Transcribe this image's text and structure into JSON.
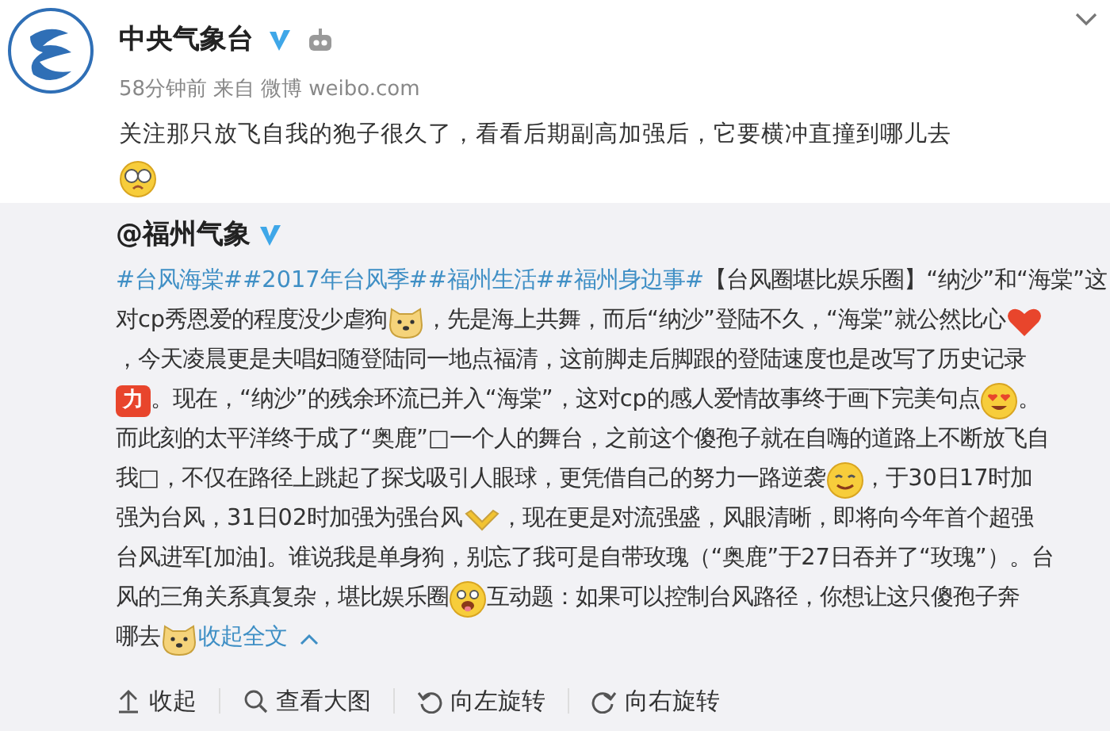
{
  "post": {
    "author": "中央气象台",
    "verified": true,
    "time": "58分钟前",
    "source_label": "来自",
    "source": "微博 weibo.com",
    "text": "关注那只放飞自我的狍子很久了，看看后期副高加强后，它要横冲直撞到哪儿去",
    "stickers": [
      {
        "kind": "glasses"
      }
    ]
  },
  "repost": {
    "author": "@福州气象",
    "verified": true,
    "lines": [
      [
        {
          "kind": "link",
          "text": "#台风海棠#"
        },
        {
          "kind": "link",
          "text": "#2017年台风季#"
        },
        {
          "kind": "link",
          "text": "#福州生活#"
        },
        {
          "kind": "link",
          "text": "#福州身边事#"
        },
        {
          "kind": "text",
          "text": " 【台风圈堪比娱乐圈】“纳沙”和“海棠”这"
        }
      ],
      [
        {
          "kind": "text",
          "text": "对cp秀恩爱的程度没少虐狗"
        },
        {
          "kind": "dog"
        },
        {
          "kind": "text",
          "text": "，先是海上共舞，而后“纳沙”登陆不久，“海棠”就公然比心"
        },
        {
          "kind": "heart"
        }
      ],
      [
        {
          "kind": "text",
          "text": "，今天凌晨更是夫唱妇随登陆同一地点福清，这前脚走后脚跟的登陆速度也是改写了历史记录"
        }
      ],
      [
        {
          "kind": "badge",
          "text": "力"
        },
        {
          "kind": "text",
          "text": "。现在，“纳沙”的残余环流已并入“海棠”，这对cp的感人爱情故事终于画下完美句点"
        },
        {
          "kind": "hearteyes"
        },
        {
          "kind": "text",
          "text": "。"
        }
      ],
      [
        {
          "kind": "text",
          "text": "而此刻的太平洋终于成了“奥鹿”□一个人的舞台，之前这个傻孢子就在自嗨的道路上不断放飞自"
        }
      ],
      [
        {
          "kind": "text",
          "text": "我□，不仅在路径上跳起了探戈吸引人眼球，更凭借自己的努力一路逆袭"
        },
        {
          "kind": "smile"
        },
        {
          "kind": "text",
          "text": "，于30日17时加"
        }
      ],
      [
        {
          "kind": "text",
          "text": "强为台风，31日02时加强为强台风"
        },
        {
          "kind": "check"
        },
        {
          "kind": "text",
          "text": "，现在更是对流强盛，风眼清晰，即将向今年首个超强"
        }
      ],
      [
        {
          "kind": "text",
          "text": "台风进军[加油]。谁说我是单身狗，别忘了我可是自带玫瑰（“奥鹿”于27日吞并了“玫瑰”）。台"
        }
      ],
      [
        {
          "kind": "text",
          "text": "风的三角关系真复杂，堪比娱乐圈"
        },
        {
          "kind": "tongue"
        },
        {
          "kind": "text",
          "text": "互动题：如果可以控制台风路径，你想让这只傻孢子奔"
        }
      ],
      [
        {
          "kind": "text",
          "text": "哪去"
        },
        {
          "kind": "dog"
        },
        {
          "kind": "link",
          "text": "收起全文"
        },
        {
          "kind": "caret"
        }
      ]
    ],
    "actions": [
      {
        "label": "收起"
      },
      {
        "label": "查看大图"
      },
      {
        "label": "向左旋转"
      },
      {
        "label": "向右旋转"
      }
    ]
  }
}
